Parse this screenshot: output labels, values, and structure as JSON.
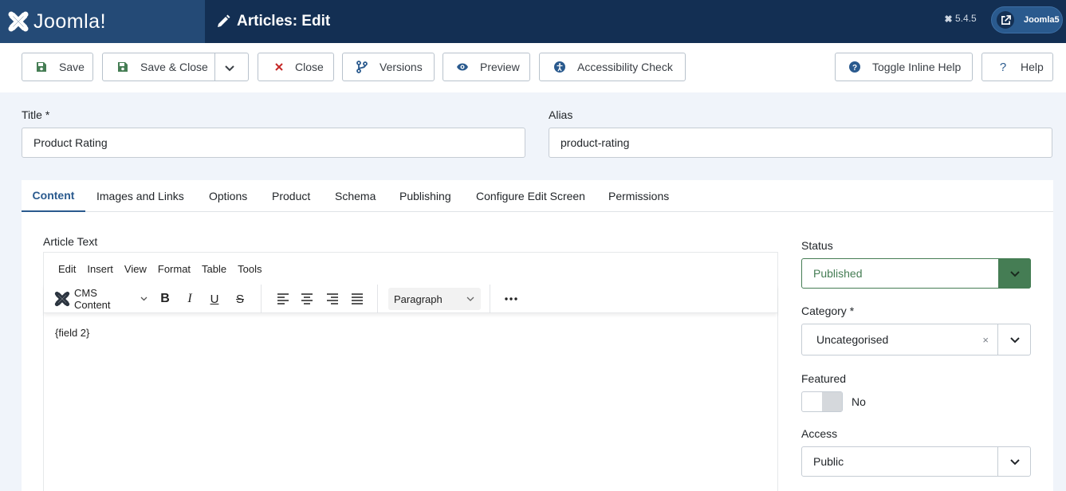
{
  "header": {
    "logo_text": "Joomla!",
    "page_title": "Articles: Edit",
    "version": "5.4.5",
    "user_label": "Joomla5"
  },
  "toolbar": {
    "save": "Save",
    "save_close": "Save & Close",
    "close": "Close",
    "versions": "Versions",
    "preview": "Preview",
    "accessibility": "Accessibility Check",
    "toggle_help": "Toggle Inline Help",
    "help": "Help"
  },
  "form": {
    "title_label": "Title *",
    "title_value": "Product Rating",
    "alias_label": "Alias",
    "alias_value": "product-rating"
  },
  "tabs": [
    "Content",
    "Images and Links",
    "Options",
    "Product",
    "Schema",
    "Publishing",
    "Configure Edit Screen",
    "Permissions"
  ],
  "editor": {
    "label": "Article Text",
    "menu": [
      "Edit",
      "Insert",
      "View",
      "Format",
      "Table",
      "Tools"
    ],
    "cms_content": "CMS Content",
    "block_format": "Paragraph",
    "body_text": "{field 2}"
  },
  "sidebar": {
    "status_label": "Status",
    "status_value": "Published",
    "category_label": "Category *",
    "category_value": "Uncategorised",
    "clear_symbol": "×",
    "featured_label": "Featured",
    "featured_value": "No",
    "access_label": "Access",
    "access_value": "Public"
  },
  "colors": {
    "header_bg": "#132f53",
    "logo_bg": "#244a76",
    "accent": "#2a5a8e",
    "status_green": "#457d54",
    "close_red": "#c52827",
    "page_bg": "#f0f4fa"
  }
}
